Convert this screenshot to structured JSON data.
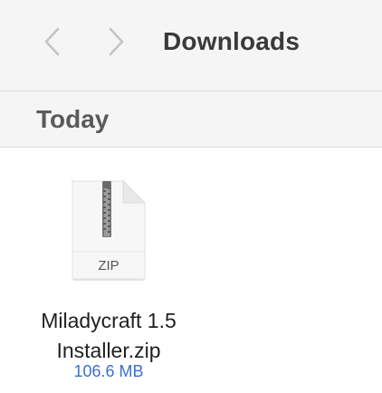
{
  "toolbar": {
    "title": "Downloads",
    "back_icon": "chevron-left-icon",
    "forward_icon": "chevron-right-icon"
  },
  "section": {
    "title": "Today"
  },
  "files": [
    {
      "name_line1": "Miladycraft 1.5",
      "name_line2": "Installer.zip",
      "size": "106.6 MB",
      "type_label": "ZIP",
      "icon": "zip-file-icon"
    }
  ],
  "colors": {
    "toolbar_bg": "#f5f5f5",
    "size_text": "#3a6fd0",
    "chevron": "#c4c4c4"
  }
}
